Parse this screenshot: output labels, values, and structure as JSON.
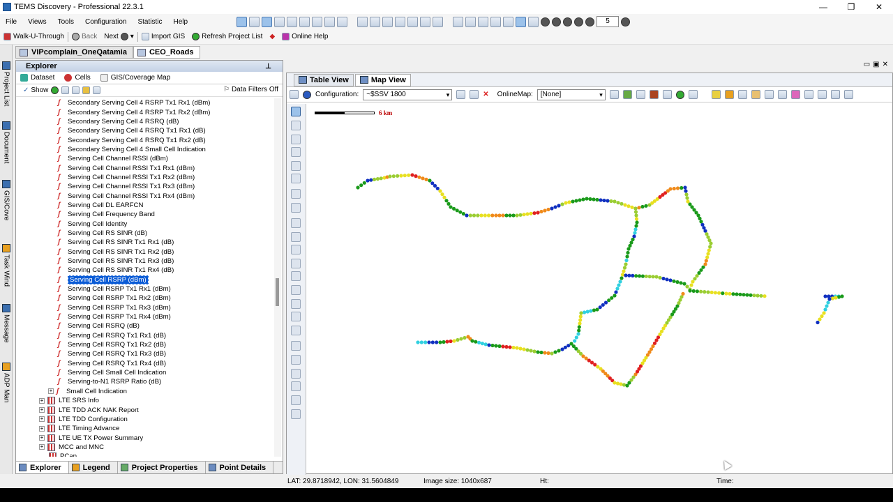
{
  "window": {
    "title": "TEMS Discovery - Professional 22.3.1",
    "controls": [
      "—",
      "❐",
      "✕"
    ]
  },
  "menu": [
    "File",
    "Views",
    "Tools",
    "Configuration",
    "Statistic",
    "Help"
  ],
  "toolbar_number": "5",
  "toolbar2": {
    "walk": "Walk-U-Through",
    "back": "Back",
    "next": "Next",
    "import_gis": "Import GIS",
    "refresh": "Refresh Project List",
    "online_help": "Online Help"
  },
  "side_tabs": [
    "Project List",
    "Document",
    "GIS/Cove",
    "Task Wind",
    "Message",
    "ADP Man"
  ],
  "doc_tabs": [
    "VIPcomplain_OneQatamia",
    "CEO_Roads"
  ],
  "explorer": {
    "title": "Explorer",
    "tabs": [
      "Dataset",
      "Cells",
      "GIS/Coverage Map"
    ],
    "show": "Show",
    "filters": "Data Filters Off",
    "tree": [
      {
        "label": "Secondary Serving Cell 4 RSRP Tx1 Rx1 (dBm)",
        "kind": "sig"
      },
      {
        "label": "Secondary Serving Cell 4 RSRP Tx1 Rx2 (dBm)",
        "kind": "sig"
      },
      {
        "label": "Secondary Serving Cell 4 RSRQ (dB)",
        "kind": "sig"
      },
      {
        "label": "Secondary Serving Cell 4 RSRQ Tx1 Rx1 (dB)",
        "kind": "sig"
      },
      {
        "label": "Secondary Serving Cell 4 RSRQ Tx1 Rx2 (dB)",
        "kind": "sig"
      },
      {
        "label": "Secondary Serving Cell 4 Small Cell Indication",
        "kind": "sig"
      },
      {
        "label": "Serving Cell Channel RSSI (dBm)",
        "kind": "sig"
      },
      {
        "label": "Serving Cell Channel RSSI Tx1 Rx1 (dBm)",
        "kind": "sig"
      },
      {
        "label": "Serving Cell Channel RSSI Tx1 Rx2 (dBm)",
        "kind": "sig"
      },
      {
        "label": "Serving Cell Channel RSSI Tx1 Rx3 (dBm)",
        "kind": "sig"
      },
      {
        "label": "Serving Cell Channel RSSI Tx1 Rx4 (dBm)",
        "kind": "sig"
      },
      {
        "label": "Serving Cell DL EARFCN",
        "kind": "sig"
      },
      {
        "label": "Serving Cell Frequency Band",
        "kind": "sig"
      },
      {
        "label": "Serving Cell Identity",
        "kind": "sig"
      },
      {
        "label": "Serving Cell RS SINR (dB)",
        "kind": "sig"
      },
      {
        "label": "Serving Cell RS SINR Tx1 Rx1 (dB)",
        "kind": "sig"
      },
      {
        "label": "Serving Cell RS SINR Tx1 Rx2 (dB)",
        "kind": "sig"
      },
      {
        "label": "Serving Cell RS SINR Tx1 Rx3 (dB)",
        "kind": "sig"
      },
      {
        "label": "Serving Cell RS SINR Tx1 Rx4 (dB)",
        "kind": "sig"
      },
      {
        "label": "Serving Cell RSRP (dBm)",
        "kind": "sig",
        "selected": true
      },
      {
        "label": "Serving Cell RSRP Tx1 Rx1 (dBm)",
        "kind": "sig"
      },
      {
        "label": "Serving Cell RSRP Tx1 Rx2 (dBm)",
        "kind": "sig"
      },
      {
        "label": "Serving Cell RSRP Tx1 Rx3 (dBm)",
        "kind": "sig"
      },
      {
        "label": "Serving Cell RSRP Tx1 Rx4 (dBm)",
        "kind": "sig"
      },
      {
        "label": "Serving Cell RSRQ (dB)",
        "kind": "sig"
      },
      {
        "label": "Serving Cell RSRQ Tx1 Rx1 (dB)",
        "kind": "sig"
      },
      {
        "label": "Serving Cell RSRQ Tx1 Rx2 (dB)",
        "kind": "sig"
      },
      {
        "label": "Serving Cell RSRQ Tx1 Rx3 (dB)",
        "kind": "sig"
      },
      {
        "label": "Serving Cell RSRQ Tx1 Rx4 (dB)",
        "kind": "sig"
      },
      {
        "label": "Serving Cell Small Cell Indication",
        "kind": "sig"
      },
      {
        "label": "Serving-to-N1 RSRP Ratio (dB)",
        "kind": "sig"
      },
      {
        "label": "Small Cell Indication",
        "kind": "sig",
        "expandable": true
      },
      {
        "label": "LTE SRS Info",
        "kind": "grp"
      },
      {
        "label": "LTE TDD ACK NAK Report",
        "kind": "grp"
      },
      {
        "label": "LTE TDD Configuration",
        "kind": "grp"
      },
      {
        "label": "LTE Timing Advance",
        "kind": "grp"
      },
      {
        "label": "LTE UE TX Power Summary",
        "kind": "grp"
      },
      {
        "label": "MCC and MNC",
        "kind": "grp"
      },
      {
        "label": "PCap",
        "kind": "grp-leaf"
      }
    ],
    "bottom_tabs": [
      "Explorer",
      "Legend",
      "Project Properties",
      "Point Details"
    ]
  },
  "map": {
    "tabs": [
      "Table View",
      "Map View"
    ],
    "config_label": "Configuration:",
    "config_value": "~$SSV 1800",
    "online_label": "OnlineMap:",
    "online_value": "[None]",
    "scale": "6 km"
  },
  "status": {
    "coords": "LAT: 29.8718942, LON: 31.5604849",
    "image_size": "Image size: 1040x687",
    "ht": "Ht:",
    "time": "Time:"
  },
  "colors": {
    "good": "#1a9a1a",
    "ok": "#9acd32",
    "fair": "#e8e020",
    "poor": "#f08a1a",
    "bad": "#e02020",
    "excellent": "#1030c0",
    "light": "#30d0e0"
  }
}
